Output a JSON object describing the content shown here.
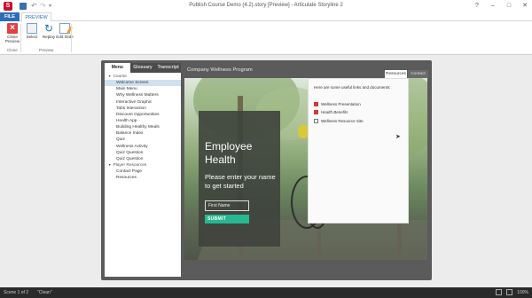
{
  "window": {
    "title": "Publish Course Demo (4.2).story [Preview] - Articulate Storyline 2",
    "app_icon_letter": "S",
    "controls": [
      "?",
      "–",
      "□",
      "✕"
    ]
  },
  "ribbon": {
    "tabs": [
      "FILE",
      "PREVIEW"
    ],
    "buttons": {
      "close": "Close Preview",
      "select": "Select",
      "replay": "Replay",
      "edit": "Edit Slide"
    },
    "groups": [
      "Close",
      "Preview"
    ]
  },
  "player": {
    "sidebar_tabs": [
      "Menu",
      "Glossary",
      "Transcript"
    ],
    "menu": [
      {
        "label": "Course",
        "type": "section"
      },
      {
        "label": "Welcome Screen",
        "type": "item",
        "selected": true
      },
      {
        "label": "Main Menu",
        "type": "item"
      },
      {
        "label": "Why Wellness Matters",
        "type": "item"
      },
      {
        "label": "Interactive Graphic",
        "type": "item"
      },
      {
        "label": "Tabs Interaction",
        "type": "item"
      },
      {
        "label": "Discount Opportunities",
        "type": "item"
      },
      {
        "label": "Health App",
        "type": "item"
      },
      {
        "label": "Building Healthy Meals",
        "type": "item"
      },
      {
        "label": "Balance Index",
        "type": "item"
      },
      {
        "label": "Quiz",
        "type": "item"
      },
      {
        "label": "Wellness Activity",
        "type": "item"
      },
      {
        "label": "Quiz Question",
        "type": "item"
      },
      {
        "label": "Quiz Question",
        "type": "item"
      },
      {
        "label": "Player Resources",
        "type": "section"
      },
      {
        "label": "Contact Page",
        "type": "item"
      },
      {
        "label": "Resources",
        "type": "item"
      }
    ],
    "slide_title": "Company Wellness Program",
    "top_tabs": [
      "Resources",
      "Contact"
    ],
    "slide": {
      "heading": "Employee Health",
      "subtitle": "Please enter your name to get started",
      "input_placeholder": "First Name",
      "submit_label": "SUBMIT"
    },
    "resources": {
      "intro": "Here are some useful links and documents:",
      "links": [
        {
          "label": "Wellness Presentation",
          "icon": "pdf-icon"
        },
        {
          "label": "Health Benefits",
          "icon": "pdf-icon"
        },
        {
          "label": "Wellness Resource Site",
          "icon": "document-icon"
        }
      ]
    }
  },
  "status": {
    "scene": "Scene 1 of 2",
    "state": "\"Clean\"",
    "zoom": "100%"
  },
  "colors": {
    "accent": "#2a6ebb",
    "submit": "#26b890",
    "menu_selected": "#cfe1ef"
  }
}
